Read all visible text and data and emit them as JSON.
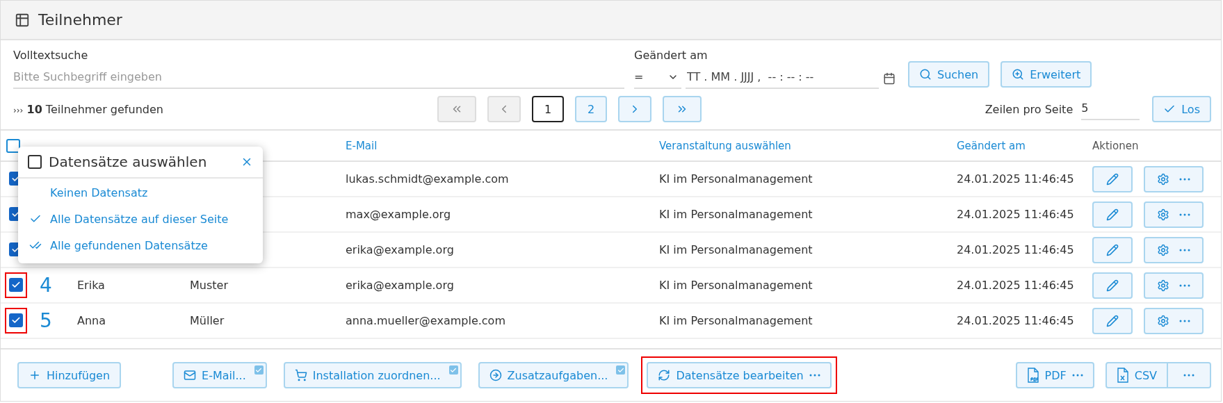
{
  "title": "Teilnehmer",
  "search": {
    "label": "Volltextsuche",
    "placeholder": "Bitte Suchbegriff eingeben"
  },
  "date_filter": {
    "label": "Geändert am",
    "operator": "=",
    "placeholder": "TT . MM . JJJJ ,  -- : -- : --"
  },
  "search_buttons": [
    {
      "kind": "search",
      "label": "Suchen"
    },
    {
      "kind": "advanced",
      "label": "Erweitert"
    }
  ],
  "result": {
    "count": "10",
    "text": "Teilnehmer gefunden",
    "marker": "›››"
  },
  "pagination": [
    {
      "kind": "first",
      "disabled": true
    },
    {
      "kind": "prev",
      "disabled": true
    },
    {
      "kind": "page",
      "label": "1",
      "selected": true
    },
    {
      "kind": "page",
      "label": "2",
      "selected": false
    },
    {
      "kind": "next",
      "disabled": false
    },
    {
      "kind": "last",
      "disabled": false
    }
  ],
  "rows_per_page": {
    "label": "Zeilen pro Seite",
    "value": "5",
    "button": "Los"
  },
  "table": {
    "select_all_checked": false,
    "columns": [
      {
        "kind": "email",
        "label": "E-Mail"
      },
      {
        "kind": "event",
        "label": "Veranstaltung auswählen"
      },
      {
        "kind": "changed",
        "label": "Geändert am"
      },
      {
        "kind": "actions",
        "label": "Aktionen"
      }
    ],
    "rows": [
      {
        "checked": true,
        "highlighted": false,
        "email": "lukas.schmidt@example.com",
        "event": "KI im Personalmanagement",
        "changed": "24.01.2025 11:46:45"
      },
      {
        "checked": true,
        "highlighted": false,
        "email": "max@example.org",
        "event": "KI im Personalmanagement",
        "changed": "24.01.2025 11:46:45"
      },
      {
        "checked": true,
        "highlighted": false,
        "email": "erika@example.org",
        "event": "KI im Personalmanagement",
        "changed": "24.01.2025 11:46:45"
      },
      {
        "checked": true,
        "highlighted": true,
        "number": "4",
        "first_name": "Erika",
        "last_name": "Muster",
        "email": "erika@example.org",
        "event": "KI im Personalmanagement",
        "changed": "24.01.2025 11:46:45"
      },
      {
        "checked": true,
        "highlighted": true,
        "number": "5",
        "first_name": "Anna",
        "last_name": "Müller",
        "email": "anna.mueller@example.com",
        "event": "KI im Personalmanagement",
        "changed": "24.01.2025 11:46:45"
      }
    ]
  },
  "select_popup": {
    "title": "Datensätze auswählen",
    "checked": false,
    "items": [
      {
        "kind": "none",
        "label": "Keinen Datensatz"
      },
      {
        "kind": "check",
        "label": "Alle Datensätze auf dieser Seite"
      },
      {
        "kind": "double-check",
        "label": "Alle gefundenen Datensätze"
      }
    ]
  },
  "footer_left": [
    {
      "kind": "add",
      "label": "Hinzufügen",
      "badge": false,
      "more": false,
      "highlighted": false
    },
    {
      "kind": "email",
      "label": "E-Mail...",
      "badge": true,
      "more": false,
      "highlighted": false
    },
    {
      "kind": "assign",
      "label": "Installation zuordnen...",
      "badge": true,
      "more": false,
      "highlighted": false
    },
    {
      "kind": "tasks",
      "label": "Zusatzaufgaben...",
      "badge": true,
      "more": false,
      "highlighted": false
    },
    {
      "kind": "edit-records",
      "label": "Datensätze bearbeiten",
      "badge": false,
      "more": true,
      "highlighted": true
    }
  ],
  "footer_right": [
    {
      "kind": "pdf",
      "label": "PDF",
      "split": false
    },
    {
      "kind": "csv",
      "label": "CSV",
      "split": true
    }
  ]
}
